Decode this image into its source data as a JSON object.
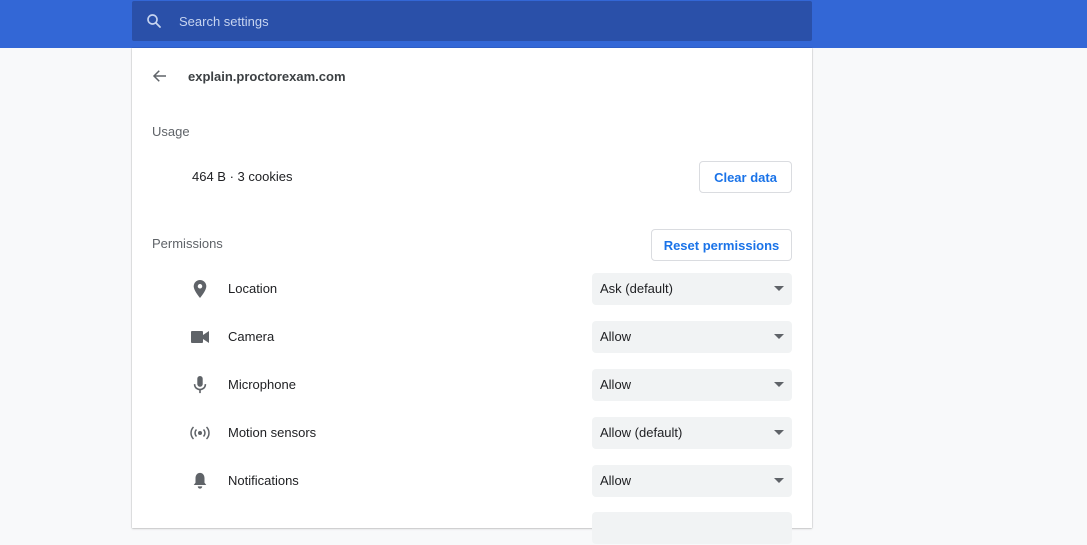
{
  "search": {
    "placeholder": "Search settings"
  },
  "header": {
    "site": "explain.proctorexam.com"
  },
  "usage": {
    "label": "Usage",
    "summary": "464 B · 3 cookies",
    "clear_button": "Clear data"
  },
  "permissions": {
    "label": "Permissions",
    "reset_button": "Reset permissions",
    "items": [
      {
        "label": "Location",
        "value": "Ask (default)",
        "icon": "location-pin-icon"
      },
      {
        "label": "Camera",
        "value": "Allow",
        "icon": "camera-icon"
      },
      {
        "label": "Microphone",
        "value": "Allow",
        "icon": "microphone-icon"
      },
      {
        "label": "Motion sensors",
        "value": "Allow (default)",
        "icon": "motion-sensors-icon"
      },
      {
        "label": "Notifications",
        "value": "Allow",
        "icon": "bell-icon"
      }
    ]
  },
  "colors": {
    "topbar": "#3367d6",
    "search_box": "#2a50a9",
    "accent": "#1a73e8"
  }
}
